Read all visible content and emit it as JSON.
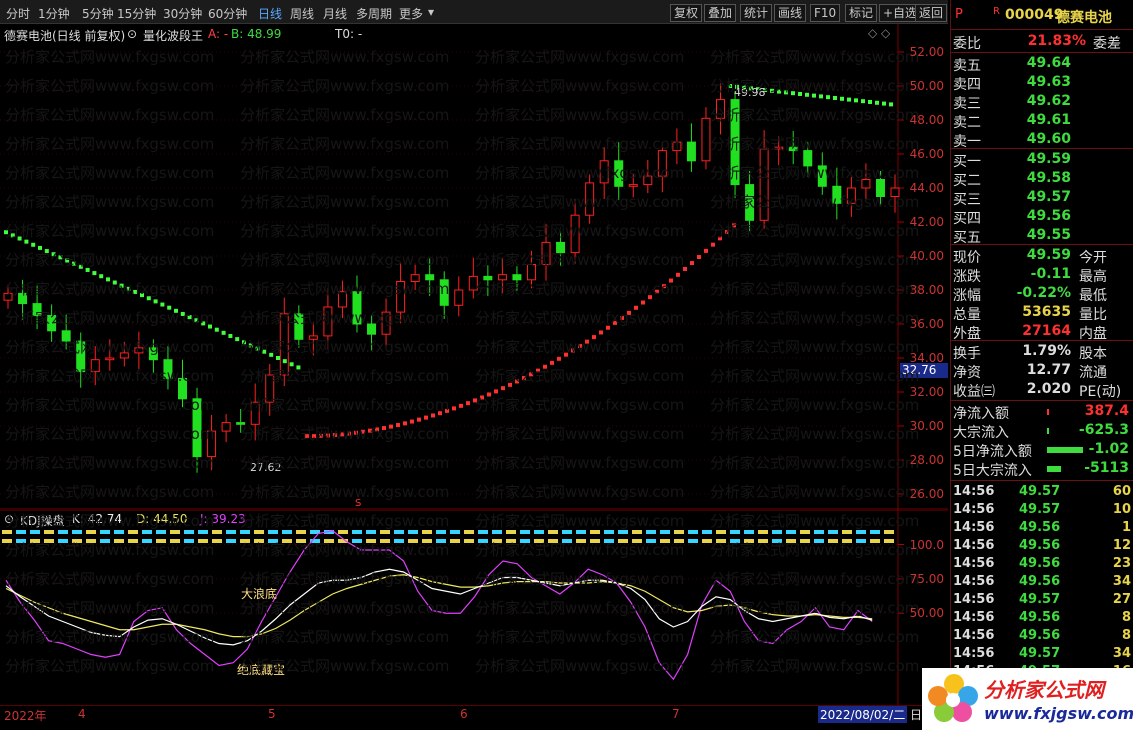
{
  "toolbar": {
    "periods": [
      "分时",
      "1分钟",
      "5分钟",
      "15分钟",
      "30分钟",
      "60分钟",
      "日线",
      "周线",
      "月线",
      "多周期",
      "更多"
    ],
    "active": "日线",
    "tools": [
      "复权",
      "叠加",
      "统计",
      "画线",
      "F10",
      "标记",
      "+自选",
      "返回"
    ]
  },
  "main": {
    "stock_name": "德赛电池(日线 前复权)",
    "indicator": "量化波段王",
    "a_label": "A: -",
    "b_label": "B: 48.99",
    "t0_label": "T0: -",
    "y_ticks": [
      "52.00",
      "50.00",
      "48.00",
      "46.00",
      "44.00",
      "42.00",
      "40.00",
      "38.00",
      "36.00",
      "34.00",
      "32.00",
      "30.00",
      "28.00",
      "26.00"
    ],
    "price_tag": "32.76",
    "high_label": "49.98",
    "low_label": "27.62",
    "marker_s": "S"
  },
  "kdj": {
    "title": "KDJ操盘",
    "k": "K: 42.74",
    "d": "D: 44.50",
    "j": "J: 39.23",
    "y_ticks": [
      "100.0",
      "75.00",
      "50.00"
    ],
    "sig_top": "大浪底",
    "sig_bottom": "绝底藏宝"
  },
  "dates": {
    "labels": [
      "2022年",
      "4",
      "5",
      "6",
      "7"
    ],
    "current": "2022/08/02/二",
    "cycle": "日"
  },
  "watermark": "分析家公式网www.fxgsw.com",
  "quote": {
    "flag": "P",
    "r": "R",
    "code": "000049",
    "name": "德赛电池",
    "weibi_label": "委比",
    "weibi": "21.83%",
    "weicha": "委差",
    "asks": [
      {
        "l": "卖五",
        "v": "49.64"
      },
      {
        "l": "卖四",
        "v": "49.63"
      },
      {
        "l": "卖三",
        "v": "49.62"
      },
      {
        "l": "卖二",
        "v": "49.61"
      },
      {
        "l": "卖一",
        "v": "49.60"
      }
    ],
    "bids": [
      {
        "l": "买一",
        "v": "49.59"
      },
      {
        "l": "买二",
        "v": "49.58"
      },
      {
        "l": "买三",
        "v": "49.57"
      },
      {
        "l": "买四",
        "v": "49.56"
      },
      {
        "l": "买五",
        "v": "49.55"
      }
    ],
    "stats": [
      {
        "l": "现价",
        "v": "49.59",
        "n": "今开"
      },
      {
        "l": "涨跌",
        "v": "-0.11",
        "n": "最高"
      },
      {
        "l": "涨幅",
        "v": "-0.22%",
        "n": "最低"
      },
      {
        "l": "总量",
        "v": "53635",
        "n": "量比"
      },
      {
        "l": "外盘",
        "v": "27164",
        "n": "内盘"
      }
    ],
    "fund": [
      {
        "l": "换手",
        "v": "1.79%",
        "n": "股本"
      },
      {
        "l": "净资",
        "v": "12.77",
        "n": "流通"
      },
      {
        "l": "收益㈢",
        "v": "2.020",
        "n": "PE(动)"
      }
    ],
    "flows": [
      {
        "l": "净流入额",
        "v": "387.4"
      },
      {
        "l": "大宗流入",
        "v": "-625.3"
      },
      {
        "l": "5日净流入额",
        "v": "-1.02"
      },
      {
        "l": "5日大宗流入",
        "v": "-5113"
      }
    ],
    "ticks": [
      [
        "14:56",
        "49.57",
        "60"
      ],
      [
        "14:56",
        "49.57",
        "10"
      ],
      [
        "14:56",
        "49.56",
        "1"
      ],
      [
        "14:56",
        "49.56",
        "12"
      ],
      [
        "14:56",
        "49.56",
        "23"
      ],
      [
        "14:56",
        "49.56",
        "34"
      ],
      [
        "14:56",
        "49.57",
        "27"
      ],
      [
        "14:56",
        "49.56",
        "8"
      ],
      [
        "14:56",
        "49.56",
        "8"
      ],
      [
        "14:56",
        "49.57",
        "34"
      ],
      [
        "14:56",
        "49.57",
        "16"
      ]
    ]
  },
  "logo": {
    "cn": "分析家公式网",
    "url": "www.fxjgsw.com"
  },
  "colors": {
    "up": "#ff2020",
    "down": "#20e020",
    "accent": "#e8d44a",
    "grid": "#5a0000"
  },
  "chart_data": {
    "type": "candlestick",
    "x": [
      "2022-03",
      "2022-04",
      "2022-05",
      "2022-06",
      "2022-07",
      "2022-08"
    ],
    "close_series": [
      37.8,
      37.2,
      36.5,
      35.6,
      35.0,
      33.2,
      33.9,
      34.0,
      34.3,
      34.6,
      33.9,
      32.8,
      31.6,
      28.2,
      29.7,
      30.2,
      30.1,
      31.4,
      33.0,
      36.6,
      35.1,
      35.3,
      37.0,
      37.9,
      36.0,
      35.4,
      36.7,
      38.5,
      38.9,
      38.6,
      37.1,
      38.0,
      38.8,
      38.6,
      38.9,
      38.6,
      39.5,
      40.8,
      40.2,
      42.4,
      44.3,
      45.6,
      44.1,
      44.2,
      44.7,
      46.2,
      46.7,
      45.6,
      48.1,
      49.2,
      44.2,
      42.1,
      46.3,
      46.4,
      46.2,
      45.3,
      44.1,
      43.1,
      44.0,
      44.5,
      43.5,
      44.0
    ],
    "ylim": [
      26,
      52
    ],
    "high": 49.98,
    "low": 27.62,
    "kdj": {
      "k": 42.74,
      "d": 44.5,
      "j": 39.23,
      "ylim": [
        0,
        120
      ]
    }
  }
}
